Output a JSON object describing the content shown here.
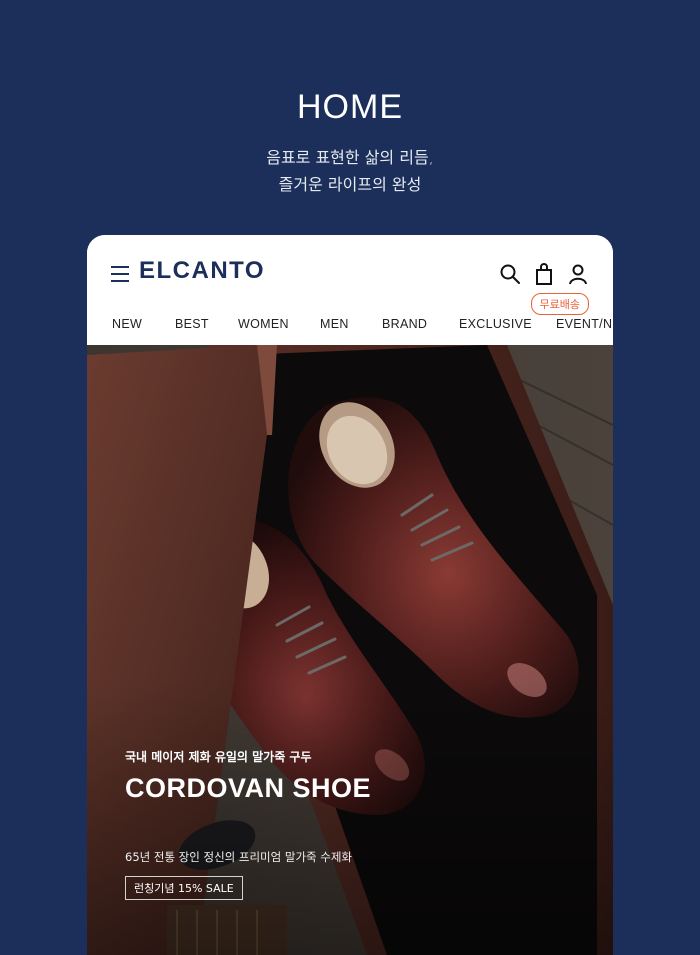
{
  "promo": {
    "title": "HOME",
    "subtitle_line1": "음표로 표현한 삶의 리듬,",
    "subtitle_line2": "즐거운 라이프의 완성"
  },
  "header": {
    "logo": "ELCANTO",
    "free_shipping_badge": "무료배송",
    "icons": [
      "menu-icon",
      "search-icon",
      "shopping-bag-icon",
      "user-icon"
    ]
  },
  "nav": {
    "items": [
      "NEW",
      "BEST",
      "WOMEN",
      "MEN",
      "BRAND",
      "EXCLUSIVE",
      "EVENT/NE"
    ]
  },
  "hero": {
    "eyebrow": "국내 메이저 제화 유일의 말가죽 구두",
    "title": "CORDOVAN SHOE",
    "description": "65년 전통 장인 정신의 프리미엄 말가죽 수제화",
    "tag": "런칭기념 15% SALE"
  },
  "colors": {
    "background": "#1b2f5a",
    "brand": "#1b2f5a",
    "badge": "#e8603c"
  }
}
